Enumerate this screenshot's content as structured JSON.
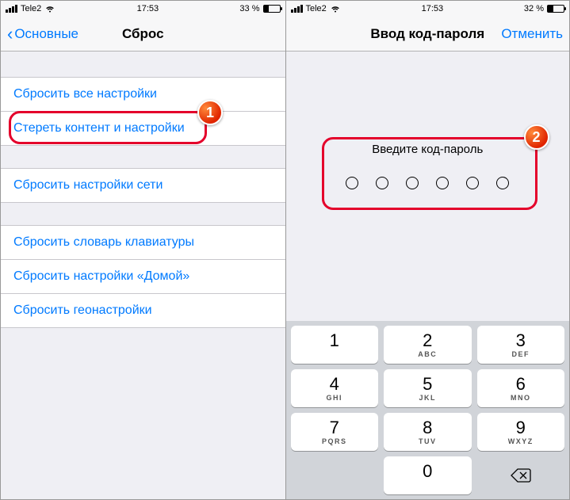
{
  "left": {
    "status": {
      "carrier": "Tele2",
      "time": "17:53",
      "battery": "33 %"
    },
    "nav": {
      "back": "Основные",
      "title": "Сброс"
    },
    "groups": [
      {
        "rows": [
          "Сбросить все настройки",
          "Стереть контент и настройки"
        ]
      },
      {
        "rows": [
          "Сбросить настройки сети"
        ]
      },
      {
        "rows": [
          "Сбросить словарь клавиатуры",
          "Сбросить настройки «Домой»",
          "Сбросить геонастройки"
        ]
      }
    ],
    "badge": "1"
  },
  "right": {
    "status": {
      "carrier": "Tele2",
      "time": "17:53",
      "battery": "32 %"
    },
    "nav": {
      "title": "Ввод код-пароля",
      "cancel": "Отменить"
    },
    "prompt": "Введите код-пароль",
    "digits": 6,
    "keypad": [
      {
        "n": "1",
        "l": ""
      },
      {
        "n": "2",
        "l": "ABC"
      },
      {
        "n": "3",
        "l": "DEF"
      },
      {
        "n": "4",
        "l": "GHI"
      },
      {
        "n": "5",
        "l": "JKL"
      },
      {
        "n": "6",
        "l": "MNO"
      },
      {
        "n": "7",
        "l": "PQRS"
      },
      {
        "n": "8",
        "l": "TUV"
      },
      {
        "n": "9",
        "l": "WXYZ"
      },
      {
        "n": "",
        "l": "",
        "blank": true
      },
      {
        "n": "0",
        "l": ""
      },
      {
        "n": "",
        "l": "",
        "del": true
      }
    ],
    "badge": "2"
  }
}
